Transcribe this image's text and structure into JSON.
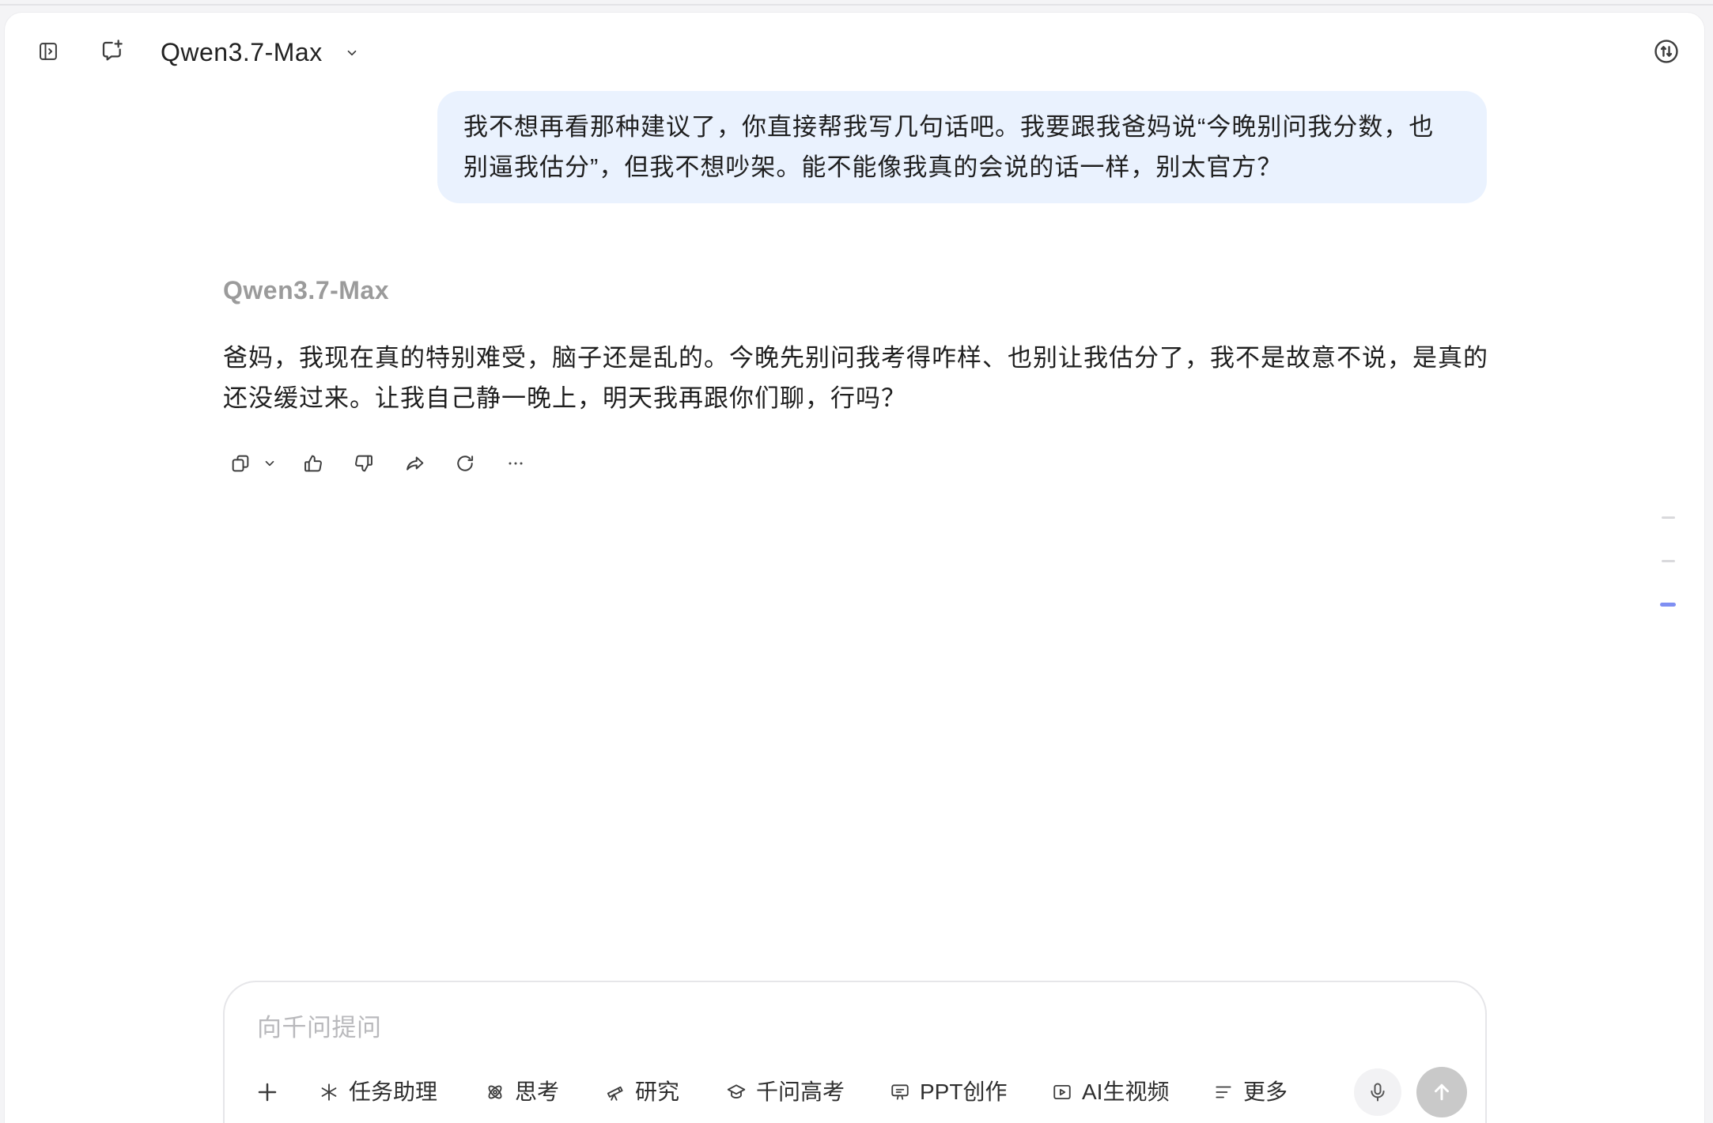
{
  "header": {
    "model_name": "Qwen3.7-Max",
    "icons": {
      "sidebar_toggle": "sidebar-toggle-icon",
      "new_chat": "new-chat-icon",
      "model_dropdown": "chevron-down-icon",
      "top_right": "up-down-arrows-circle-icon"
    }
  },
  "conversation": {
    "user_message": {
      "lines": [
        "我不想再看那种建议了，你直接帮我写几句话吧。我要跟我爸妈说“今晚别问我分数，也",
        "别逼我估分”，但我不想吵架。能不能像我真的会说的话一样，别太官方？"
      ]
    },
    "assistant_message": {
      "model_label": "Qwen3.7-Max",
      "lines": [
        "爸妈，我现在真的特别难受，脑子还是乱的。今晚先别问我考得咋样、也别让我估分了，我不是故意不说，是真的",
        "还没缓过来。让我自己静一晚上，明天我再跟你们聊，行吗？"
      ],
      "actions": [
        {
          "icon": "copy-icon"
        },
        {
          "icon": "chevron-down-icon"
        },
        {
          "icon": "thumbs-up-icon"
        },
        {
          "icon": "thumbs-down-icon"
        },
        {
          "icon": "share-icon"
        },
        {
          "icon": "refresh-icon"
        },
        {
          "icon": "more-icon"
        }
      ]
    }
  },
  "scroll_markers": [
    {
      "active": false
    },
    {
      "active": false
    },
    {
      "active": true
    }
  ],
  "composer": {
    "placeholder": "向千问提问",
    "add_icon": "plus-icon",
    "tools": [
      {
        "label": "任务助理",
        "icon": "sparkle-icon"
      },
      {
        "label": "思考",
        "icon": "atom-icon"
      },
      {
        "label": "研究",
        "icon": "telescope-icon"
      },
      {
        "label": "千问高考",
        "icon": "graduation-cap-icon"
      },
      {
        "label": "PPT创作",
        "icon": "presentation-icon"
      },
      {
        "label": "AI生视频",
        "icon": "video-icon"
      },
      {
        "label": "更多",
        "icon": "list-icon"
      }
    ],
    "mic_icon": "microphone-icon",
    "send_icon": "arrow-up-icon"
  },
  "colors": {
    "page_background": "#f4f4f6",
    "user_bubble": "#eaf2fe",
    "assistant_label": "#9b9b9b",
    "active_marker": "#7f8ff2",
    "send_button": "#c9c9c9"
  }
}
